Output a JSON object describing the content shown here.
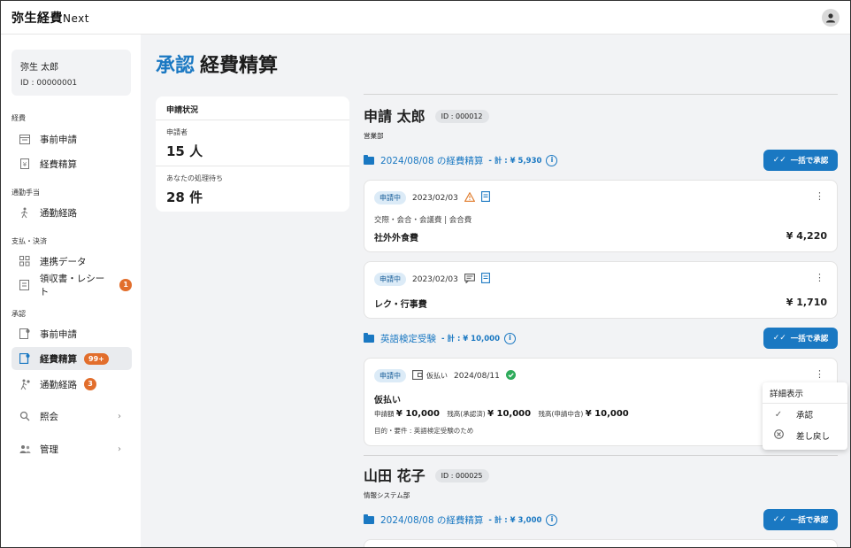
{
  "app": {
    "logo_main": "弥生経費",
    "logo_sub": "Next"
  },
  "user": {
    "name": "弥生 太郎",
    "id": "ID : 00000001"
  },
  "sidebar": {
    "sections": [
      {
        "label": "経費",
        "items": [
          {
            "label": "事前申請"
          },
          {
            "label": "経費精算"
          }
        ]
      },
      {
        "label": "通勤手当",
        "items": [
          {
            "label": "通勤経路"
          }
        ]
      },
      {
        "label": "支払・決済",
        "items": [
          {
            "label": "連携データ"
          },
          {
            "label": "領収書・レシート",
            "badge": "1"
          }
        ]
      },
      {
        "label": "承認",
        "items": [
          {
            "label": "事前申請"
          },
          {
            "label": "経費精算",
            "badge": "99+"
          },
          {
            "label": "通勤経路",
            "badge": "3"
          }
        ]
      }
    ],
    "extra": [
      {
        "label": "照会"
      },
      {
        "label": "管理"
      }
    ]
  },
  "page": {
    "title_accent": "承認",
    "title": "経費精算"
  },
  "status": {
    "header": "申請状況",
    "applicants_label": "申請者",
    "applicants_value": "15 人",
    "pending_label": "あなたの処理待ち",
    "pending_value": "28 件"
  },
  "people": [
    {
      "name": "申請 太郎",
      "id": "ID : 000012",
      "dept": "営業部",
      "groups": [
        {
          "title": "2024/08/08 の経費精算",
          "total": "- 計 : ¥ 5,930",
          "button": "一括で承認",
          "cards": [
            {
              "status": "申請中",
              "date": "2023/02/03",
              "category": "交際・会合・会議費 | 会合費",
              "name": "社外外食費",
              "amount": "¥ 4,220"
            },
            {
              "status": "申請中",
              "date": "2023/02/03",
              "name": "レク・行事費",
              "amount": "¥ 1,710"
            }
          ]
        },
        {
          "title": "英語検定受験",
          "total": "- 計 : ¥ 10,000",
          "button": "一括で承認",
          "cards": [
            {
              "status": "申請中",
              "type_label": "仮払い",
              "date": "2024/08/11",
              "name": "仮払い",
              "req_label": "申請額",
              "req_value": "¥ 10,000",
              "approved_label": "残高(承認済)",
              "approved_value": "¥ 10,000",
              "pending_label": "残高(申請中含)",
              "pending_value": "¥ 10,000",
              "purpose": "目的・要件 : 英語検定受験のため"
            }
          ]
        }
      ]
    },
    {
      "name": "山田 花子",
      "id": "ID : 000025",
      "dept": "情報システム部",
      "groups": [
        {
          "title": "2024/08/08 の経費精算",
          "total": "- 計 : ¥ 3,000",
          "button": "一括で承認"
        }
      ]
    }
  ],
  "context_menu": {
    "detail": "詳細表示",
    "approve": "承認",
    "return": "差し戻し"
  },
  "colors": {
    "accent": "#1a78c2",
    "badge": "#e26e2c",
    "warning": "#e07b2b",
    "success": "#2eab5b"
  }
}
